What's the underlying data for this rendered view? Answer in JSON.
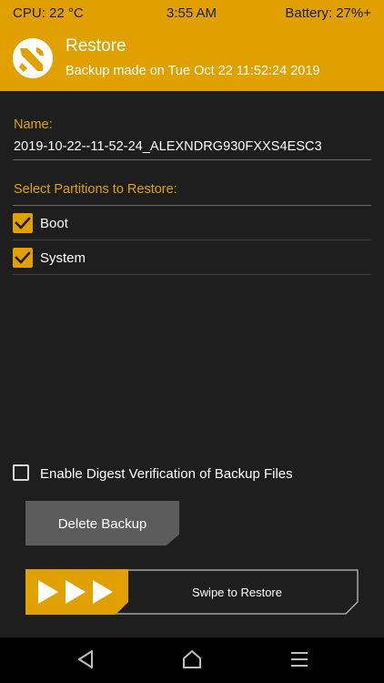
{
  "status_bar": {
    "cpu": "CPU: 22 °C",
    "time": "3:55 AM",
    "battery": "Battery: 27%+"
  },
  "header": {
    "title": "Restore",
    "subtitle": "Backup made on Tue Oct 22 11:52:24 2019",
    "logo_icon": "twrp-logo-icon"
  },
  "form": {
    "name_label": "Name:",
    "name_value": "2019-10-22--11-52-24_ALEXNDRG930FXXS4ESC3",
    "partitions_label": "Select Partitions to Restore:",
    "partitions": [
      {
        "label": "Boot",
        "checked": true
      },
      {
        "label": "System",
        "checked": true
      }
    ],
    "digest_label": "Enable Digest Verification of Backup Files",
    "digest_checked": false
  },
  "actions": {
    "delete_label": "Delete Backup",
    "swipe_label": "Swipe to Restore"
  },
  "nav": {
    "back_icon": "back-triangle-icon",
    "home_icon": "home-icon",
    "menu_icon": "menu-lines-icon"
  },
  "colors": {
    "accent": "#e0a100",
    "background": "#1e1e1e",
    "button": "#5c5c5c",
    "navbar": "#000000"
  }
}
